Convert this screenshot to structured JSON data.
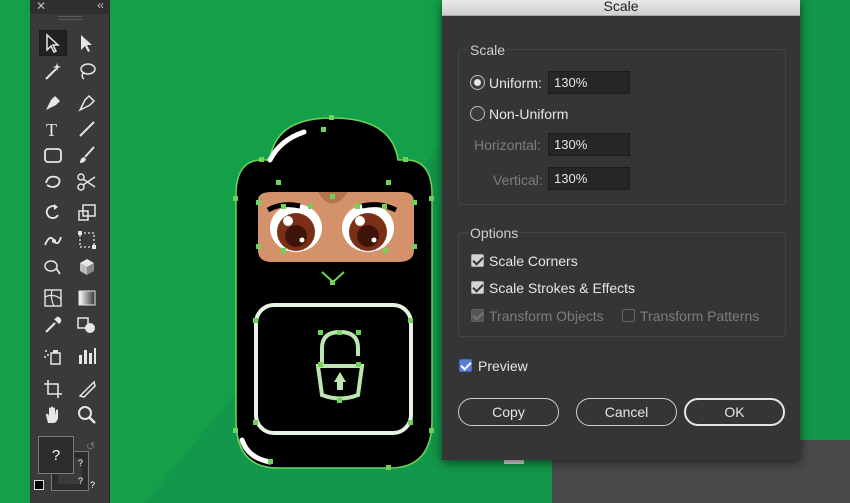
{
  "dialog": {
    "title": "Scale",
    "scale_group": {
      "title": "Scale",
      "uniform_label": "Uniform:",
      "uniform_value": "130%",
      "non_uniform_label": "Non-Uniform",
      "horizontal_label": "Horizontal:",
      "horizontal_value": "130%",
      "vertical_label": "Vertical:",
      "vertical_value": "130%",
      "selected": "uniform"
    },
    "options_group": {
      "title": "Options",
      "scale_corners": "Scale Corners",
      "scale_strokes": "Scale Strokes & Effects",
      "transform_objects": "Transform Objects",
      "transform_patterns": "Transform Patterns"
    },
    "preview_label": "Preview",
    "buttons": {
      "copy": "Copy",
      "cancel": "Cancel",
      "ok": "OK"
    }
  },
  "toolbar": {
    "fill_stroke_glyph": "?",
    "tools": [
      "selection",
      "direct-selection",
      "magic-wand",
      "lasso",
      "pen",
      "curvature",
      "type",
      "line-segment",
      "rectangle",
      "paintbrush",
      "shaper",
      "scissors",
      "rotate",
      "scale",
      "puppet-warp",
      "free-transform",
      "shape-builder",
      "perspective",
      "mesh",
      "gradient",
      "eyedropper",
      "blend",
      "symbol-sprayer",
      "column-graph",
      "artboard",
      "slice",
      "hand",
      "zoom"
    ]
  },
  "colors": {
    "canvas": "#14a049",
    "panel": "#3a3a3a",
    "dialog": "#353535",
    "character_body": "#000000",
    "skin": "#d4926a",
    "eyes": "#7b2f17",
    "path_highlight": "#6fd35a"
  }
}
